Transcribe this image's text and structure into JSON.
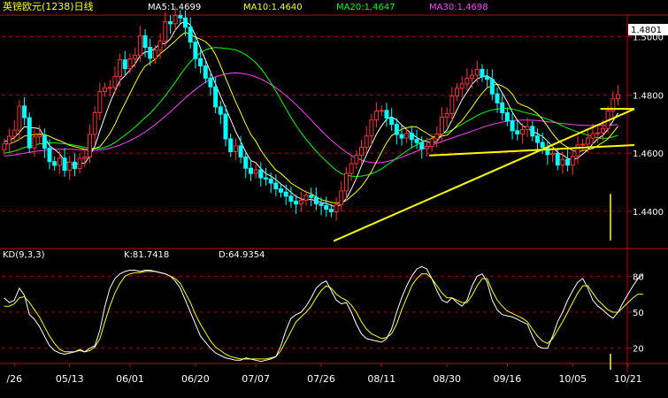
{
  "header": {
    "title": "英镑欧元(1238)日线",
    "ma": [
      {
        "label": "MA5:1.4699",
        "color": "#ffffff"
      },
      {
        "label": "MA10:1.4640",
        "color": "#ffff00"
      },
      {
        "label": "MA20:1.4647",
        "color": "#00ff00"
      },
      {
        "label": "MA30:1.4698",
        "color": "#ff40ff"
      }
    ]
  },
  "price_axis": {
    "ticks": [
      {
        "v": 1.5,
        "label": "1.5000"
      },
      {
        "v": 1.48,
        "label": "1.4800"
      },
      {
        "v": 1.46,
        "label": "1.4600"
      },
      {
        "v": 1.44,
        "label": "1.4400"
      }
    ],
    "current_label": "1.4801",
    "current_value": 1.4801,
    "ylim": [
      1.4275,
      1.5075
    ]
  },
  "kd_header": {
    "name": "KD(9,3,3)",
    "k_label": "K:81.7418",
    "d_label": "D:64.9354"
  },
  "kd_axis": {
    "ticks": [
      {
        "v": 80,
        "label": "80"
      },
      {
        "v": 50,
        "label": "50"
      },
      {
        "v": 20,
        "label": "20"
      }
    ],
    "ylim": [
      8,
      92
    ]
  },
  "date_labels": [
    {
      "i": 2,
      "label": "/26"
    },
    {
      "i": 13,
      "label": "05/13"
    },
    {
      "i": 25,
      "label": "06/01"
    },
    {
      "i": 38,
      "label": "06/20"
    },
    {
      "i": 50,
      "label": "07/07"
    },
    {
      "i": 63,
      "label": "07/26"
    },
    {
      "i": 75,
      "label": "08/11"
    },
    {
      "i": 88,
      "label": "08/30"
    },
    {
      "i": 100,
      "label": "09/16"
    },
    {
      "i": 113,
      "label": "10/05"
    },
    {
      "i": 124,
      "label": "10/21"
    }
  ],
  "colors": {
    "up": "#ff3030",
    "down": "#00ffff",
    "grid": "#a00000",
    "frame": "#c00000",
    "ma5": "#ffffff",
    "ma10": "#ffff00",
    "ma20": "#00ff00",
    "ma30": "#ff40ff",
    "k": "#ffffff",
    "d": "#ffff00",
    "trend": "#ffff00"
  },
  "chart_data": {
    "type": "candlestick",
    "title": "英镑欧元(1238)日线",
    "ylabel": "",
    "xlabel": "",
    "ylim": [
      1.4275,
      1.5075
    ],
    "x_tick_labels": [
      "/26",
      "05/13",
      "06/01",
      "06/20",
      "07/07",
      "07/26",
      "08/11",
      "08/30",
      "09/16",
      "10/05",
      "10/21"
    ],
    "closes": [
      1.4632,
      1.4658,
      1.4679,
      1.4762,
      1.4722,
      1.4618,
      1.4656,
      1.4663,
      1.4617,
      1.4571,
      1.4558,
      1.4583,
      1.4541,
      1.4569,
      1.4547,
      1.4582,
      1.4587,
      1.4665,
      1.4739,
      1.4812,
      1.4825,
      1.4826,
      1.4864,
      1.4921,
      1.4891,
      1.4924,
      1.4937,
      1.5004,
      1.4964,
      1.4926,
      1.4954,
      1.4986,
      1.5052,
      1.5045,
      1.5074,
      1.5065,
      1.5033,
      1.4982,
      1.4925,
      1.49,
      1.4858,
      1.4828,
      1.4759,
      1.4734,
      1.4649,
      1.4605,
      1.4625,
      1.4587,
      1.4548,
      1.453,
      1.4543,
      1.4515,
      1.4511,
      1.4497,
      1.4477,
      1.4466,
      1.4452,
      1.4435,
      1.4425,
      1.4438,
      1.4455,
      1.4448,
      1.4426,
      1.442,
      1.4407,
      1.4398,
      1.4423,
      1.447,
      1.453,
      1.4564,
      1.4593,
      1.462,
      1.4659,
      1.4714,
      1.4745,
      1.4747,
      1.4721,
      1.4699,
      1.4664,
      1.4652,
      1.4668,
      1.4647,
      1.4636,
      1.4615,
      1.4623,
      1.4649,
      1.4666,
      1.4724,
      1.4736,
      1.4797,
      1.4823,
      1.4838,
      1.4858,
      1.4868,
      1.4888,
      1.4863,
      1.4854,
      1.4804,
      1.4773,
      1.4739,
      1.4711,
      1.4677,
      1.4666,
      1.4681,
      1.4692,
      1.4659,
      1.4637,
      1.462,
      1.4595,
      1.4599,
      1.4559,
      1.4579,
      1.4559,
      1.4589,
      1.4628,
      1.4631,
      1.4652,
      1.4667,
      1.467,
      1.4685,
      1.4745,
      1.4787,
      1.4801
    ],
    "opens": [
      1.4612,
      1.4632,
      1.4658,
      1.4679,
      1.4762,
      1.4722,
      1.4618,
      1.4656,
      1.4663,
      1.4617,
      1.4571,
      1.4558,
      1.4583,
      1.4541,
      1.4569,
      1.4547,
      1.4582,
      1.4587,
      1.4665,
      1.4739,
      1.4812,
      1.4825,
      1.4826,
      1.4864,
      1.4921,
      1.4891,
      1.4924,
      1.4937,
      1.5004,
      1.4964,
      1.4926,
      1.4954,
      1.4986,
      1.5052,
      1.5045,
      1.5074,
      1.5065,
      1.5033,
      1.4982,
      1.4925,
      1.49,
      1.4858,
      1.4828,
      1.4759,
      1.4734,
      1.4649,
      1.4605,
      1.4625,
      1.4587,
      1.4548,
      1.453,
      1.4543,
      1.4515,
      1.4511,
      1.4497,
      1.4477,
      1.4466,
      1.4452,
      1.4435,
      1.4425,
      1.4438,
      1.4455,
      1.4448,
      1.4426,
      1.442,
      1.4407,
      1.4398,
      1.4423,
      1.447,
      1.453,
      1.4564,
      1.4593,
      1.462,
      1.4659,
      1.4714,
      1.4745,
      1.4747,
      1.4721,
      1.4699,
      1.4664,
      1.4652,
      1.4668,
      1.4647,
      1.4636,
      1.4615,
      1.4623,
      1.4649,
      1.4666,
      1.4724,
      1.4736,
      1.4797,
      1.4823,
      1.4838,
      1.4858,
      1.4868,
      1.4888,
      1.4863,
      1.4854,
      1.4804,
      1.4773,
      1.4739,
      1.4711,
      1.4677,
      1.4666,
      1.4681,
      1.4692,
      1.4659,
      1.4637,
      1.462,
      1.4595,
      1.4599,
      1.4559,
      1.4579,
      1.4559,
      1.4589,
      1.4628,
      1.4631,
      1.4652,
      1.4667,
      1.467,
      1.4685,
      1.4745,
      1.4787
    ],
    "ma5": [
      1.464,
      1.4644,
      1.4653,
      1.4671,
      1.4691,
      1.4688,
      1.4687,
      1.4684,
      1.4655,
      1.4625,
      1.4613,
      1.4598,
      1.4574,
      1.4564,
      1.456,
      1.4566,
      1.4565,
      1.459,
      1.4624,
      1.4677,
      1.4726,
      1.4773,
      1.4813,
      1.485,
      1.4866,
      1.4886,
      1.4907,
      1.4935,
      1.4948,
      1.4949,
      1.4961,
      1.4977,
      1.4976,
      1.4993,
      1.5023,
      1.5045,
      1.5054,
      1.504,
      1.5005,
      1.4961,
      1.492,
      1.4879,
      1.4838,
      1.4796,
      1.4756,
      1.4715,
      1.4674,
      1.464,
      1.4604,
      1.4575,
      1.4567,
      1.4547,
      1.453,
      1.4521,
      1.4509,
      1.4494,
      1.4481,
      1.4465,
      1.4451,
      1.4443,
      1.4439,
      1.4441,
      1.4436,
      1.443,
      1.4428,
      1.442,
      1.4415,
      1.4424,
      1.4444,
      1.4476,
      1.4514,
      1.4556,
      1.4594,
      1.463,
      1.4666,
      1.4694,
      1.4717,
      1.4725,
      1.4714,
      1.4697,
      1.4681,
      1.4666,
      1.4654,
      1.4644,
      1.464,
      1.4634,
      1.4641,
      1.4663,
      1.468,
      1.4714,
      1.4749,
      1.4784,
      1.481,
      1.4837,
      1.4855,
      1.4863,
      1.4866,
      1.4855,
      1.4836,
      1.4807,
      1.4776,
      1.4741,
      1.4713,
      1.4695,
      1.4685,
      1.4675,
      1.4667,
      1.4658,
      1.4641,
      1.4622,
      1.4602,
      1.4594,
      1.4582,
      1.4577,
      1.4583,
      1.4597,
      1.4611,
      1.4632,
      1.465,
      1.4661,
      1.4682,
      1.4711,
      1.4738
    ],
    "ma10": [
      1.463,
      1.4633,
      1.4638,
      1.4648,
      1.4659,
      1.4662,
      1.4664,
      1.4666,
      1.4663,
      1.4658,
      1.4649,
      1.4643,
      1.4635,
      1.4627,
      1.4622,
      1.4618,
      1.4613,
      1.4612,
      1.4616,
      1.4622,
      1.4644,
      1.4668,
      1.4699,
      1.4737,
      1.4771,
      1.4806,
      1.484,
      1.4874,
      1.4899,
      1.4911,
      1.4923,
      1.4942,
      1.4956,
      1.4971,
      1.4986,
      1.5003,
      1.5015,
      1.5008,
      1.4999,
      1.4992,
      1.4983,
      1.4967,
      1.4939,
      1.49,
      1.4858,
      1.4817,
      1.4776,
      1.4739,
      1.47,
      1.4665,
      1.4641,
      1.461,
      1.4585,
      1.4562,
      1.4542,
      1.453,
      1.4514,
      1.4497,
      1.4486,
      1.4476,
      1.4466,
      1.4461,
      1.445,
      1.444,
      1.4435,
      1.4431,
      1.4428,
      1.443,
      1.4437,
      1.4452,
      1.4467,
      1.4485,
      1.4509,
      1.4537,
      1.4571,
      1.4604,
      1.4635,
      1.466,
      1.4672,
      1.4682,
      1.4688,
      1.4691,
      1.469,
      1.4679,
      1.4669,
      1.4657,
      1.4654,
      1.4659,
      1.4662,
      1.4677,
      1.4695,
      1.4712,
      1.4735,
      1.4758,
      1.4784,
      1.4806,
      1.4825,
      1.4832,
      1.4837,
      1.4831,
      1.4821,
      1.4803,
      1.4774,
      1.4765,
      1.4759,
      1.4749,
      1.4735,
      1.4716,
      1.4692,
      1.4667,
      1.4646,
      1.4631,
      1.462,
      1.4609,
      1.4604,
      1.4609,
      1.4612,
      1.4616,
      1.4626,
      1.4637,
      1.4649,
      1.467,
      1.4693
    ],
    "ma20": [
      1.46,
      1.4603,
      1.4607,
      1.4613,
      1.462,
      1.4624,
      1.4628,
      1.4632,
      1.4634,
      1.4635,
      1.4635,
      1.4634,
      1.4632,
      1.463,
      1.4627,
      1.4624,
      1.462,
      1.4617,
      1.4616,
      1.4616,
      1.462,
      1.4627,
      1.4636,
      1.4649,
      1.4662,
      1.4675,
      1.469,
      1.4706,
      1.4722,
      1.4737,
      1.4756,
      1.4776,
      1.4797,
      1.482,
      1.4844,
      1.4869,
      1.4893,
      1.4914,
      1.4931,
      1.4945,
      1.4955,
      1.4961,
      1.4963,
      1.4962,
      1.496,
      1.4958,
      1.4955,
      1.4948,
      1.4939,
      1.4926,
      1.4911,
      1.4891,
      1.4868,
      1.4842,
      1.4813,
      1.4783,
      1.4753,
      1.4723,
      1.4695,
      1.467,
      1.4648,
      1.4627,
      1.4607,
      1.4589,
      1.4572,
      1.4556,
      1.4541,
      1.453,
      1.4524,
      1.4521,
      1.452,
      1.4521,
      1.4524,
      1.4529,
      1.4536,
      1.4546,
      1.4558,
      1.457,
      1.4583,
      1.4596,
      1.4608,
      1.4619,
      1.4629,
      1.4637,
      1.4645,
      1.4652,
      1.4659,
      1.4666,
      1.4672,
      1.468,
      1.469,
      1.4699,
      1.471,
      1.4719,
      1.4729,
      1.4737,
      1.4744,
      1.4749,
      1.4752,
      1.4754,
      1.4754,
      1.4752,
      1.4747,
      1.4742,
      1.4738,
      1.4734,
      1.4729,
      1.4723,
      1.4717,
      1.471,
      1.4702,
      1.4694,
      1.4686,
      1.4679,
      1.4673,
      1.4667,
      1.4662,
      1.4656,
      1.4652,
      1.4651,
      1.4652,
      1.4656,
      1.4661
    ],
    "ma30": [
      1.459,
      1.4592,
      1.4594,
      1.4597,
      1.46,
      1.4603,
      1.4606,
      1.4608,
      1.461,
      1.4612,
      1.4613,
      1.4614,
      1.4614,
      1.4614,
      1.4613,
      1.4612,
      1.4611,
      1.461,
      1.461,
      1.4611,
      1.4613,
      1.4617,
      1.4622,
      1.4628,
      1.4635,
      1.4643,
      1.4652,
      1.4662,
      1.4673,
      1.4685,
      1.4698,
      1.4712,
      1.4727,
      1.4742,
      1.4758,
      1.4774,
      1.479,
      1.4805,
      1.4819,
      1.4832,
      1.4844,
      1.4854,
      1.4862,
      1.4868,
      1.4872,
      1.4875,
      1.4876,
      1.4875,
      1.4872,
      1.4868,
      1.4862,
      1.4855,
      1.4846,
      1.4836,
      1.4825,
      1.4812,
      1.4798,
      1.4783,
      1.4767,
      1.475,
      1.4732,
      1.4714,
      1.4696,
      1.4678,
      1.4661,
      1.4645,
      1.463,
      1.4616,
      1.4603,
      1.4592,
      1.4583,
      1.4576,
      1.4571,
      1.4568,
      1.4567,
      1.4568,
      1.4571,
      1.4575,
      1.458,
      1.4586,
      1.4593,
      1.46,
      1.4607,
      1.4614,
      1.4621,
      1.4628,
      1.4634,
      1.464,
      1.4646,
      1.4652,
      1.4658,
      1.4664,
      1.467,
      1.4676,
      1.4682,
      1.4688,
      1.4694,
      1.4699,
      1.4703,
      1.4707,
      1.471,
      1.4712,
      1.4713,
      1.4714,
      1.4714,
      1.4713,
      1.4712,
      1.471,
      1.4708,
      1.4706,
      1.4704,
      1.4702,
      1.47,
      1.4698,
      1.4697,
      1.4696,
      1.4695,
      1.4695,
      1.4695,
      1.4695,
      1.4696,
      1.4697,
      1.4698
    ],
    "k": [
      62,
      58,
      60,
      70,
      64,
      48,
      44,
      38,
      30,
      22,
      18,
      16,
      15,
      16,
      17,
      19,
      17,
      20,
      22,
      35,
      55,
      70,
      78,
      82,
      84,
      85,
      85,
      84,
      85,
      85,
      84,
      83,
      82,
      80,
      76,
      70,
      60,
      50,
      40,
      30,
      25,
      20,
      16,
      14,
      12,
      11,
      10,
      10,
      12,
      11,
      10,
      9,
      10,
      11,
      13,
      22,
      35,
      45,
      48,
      50,
      55,
      62,
      70,
      74,
      76,
      68,
      60,
      57,
      58,
      50,
      40,
      32,
      28,
      27,
      26,
      25,
      28,
      36,
      50,
      62,
      72,
      80,
      86,
      88,
      86,
      78,
      68,
      60,
      58,
      62,
      58,
      55,
      60,
      72,
      80,
      82,
      75,
      60,
      52,
      48,
      47,
      46,
      44,
      42,
      40,
      30,
      22,
      20,
      20,
      30,
      42,
      50,
      60,
      68,
      75,
      78,
      70,
      60,
      55,
      52,
      48,
      45,
      50,
      58,
      65,
      72,
      78,
      82
    ],
    "d": [
      55,
      55,
      57,
      62,
      63,
      58,
      52,
      46,
      38,
      30,
      24,
      19,
      17,
      17,
      17,
      18,
      17,
      18,
      21,
      28,
      42,
      55,
      66,
      74,
      80,
      82,
      83,
      83,
      84,
      84,
      84,
      83,
      82,
      80,
      78,
      74,
      66,
      58,
      48,
      40,
      33,
      26,
      21,
      18,
      15,
      13,
      12,
      11,
      11,
      11,
      11,
      11,
      11,
      12,
      13,
      18,
      26,
      34,
      42,
      46,
      50,
      55,
      62,
      68,
      72,
      70,
      65,
      62,
      60,
      56,
      50,
      42,
      36,
      32,
      30,
      28,
      29,
      32,
      40,
      52,
      62,
      72,
      78,
      82,
      82,
      78,
      72,
      66,
      62,
      62,
      60,
      58,
      58,
      64,
      72,
      78,
      78,
      68,
      60,
      55,
      51,
      49,
      47,
      45,
      42,
      36,
      30,
      26,
      24,
      28,
      35,
      42,
      50,
      58,
      66,
      72,
      72,
      66,
      60,
      56,
      52,
      50,
      50,
      54,
      58,
      62,
      65,
      65
    ],
    "trendlines": [
      {
        "x1": 65.5,
        "y1": 1.4298,
        "x2": 130.5,
        "y2": 1.4752
      },
      {
        "x1": 84.5,
        "y1": 1.4592,
        "x2": 130.5,
        "y2": 1.4628
      },
      {
        "x1": 118.5,
        "y1": 1.4752,
        "x2": 130.5,
        "y2": 1.4752
      }
    ]
  }
}
